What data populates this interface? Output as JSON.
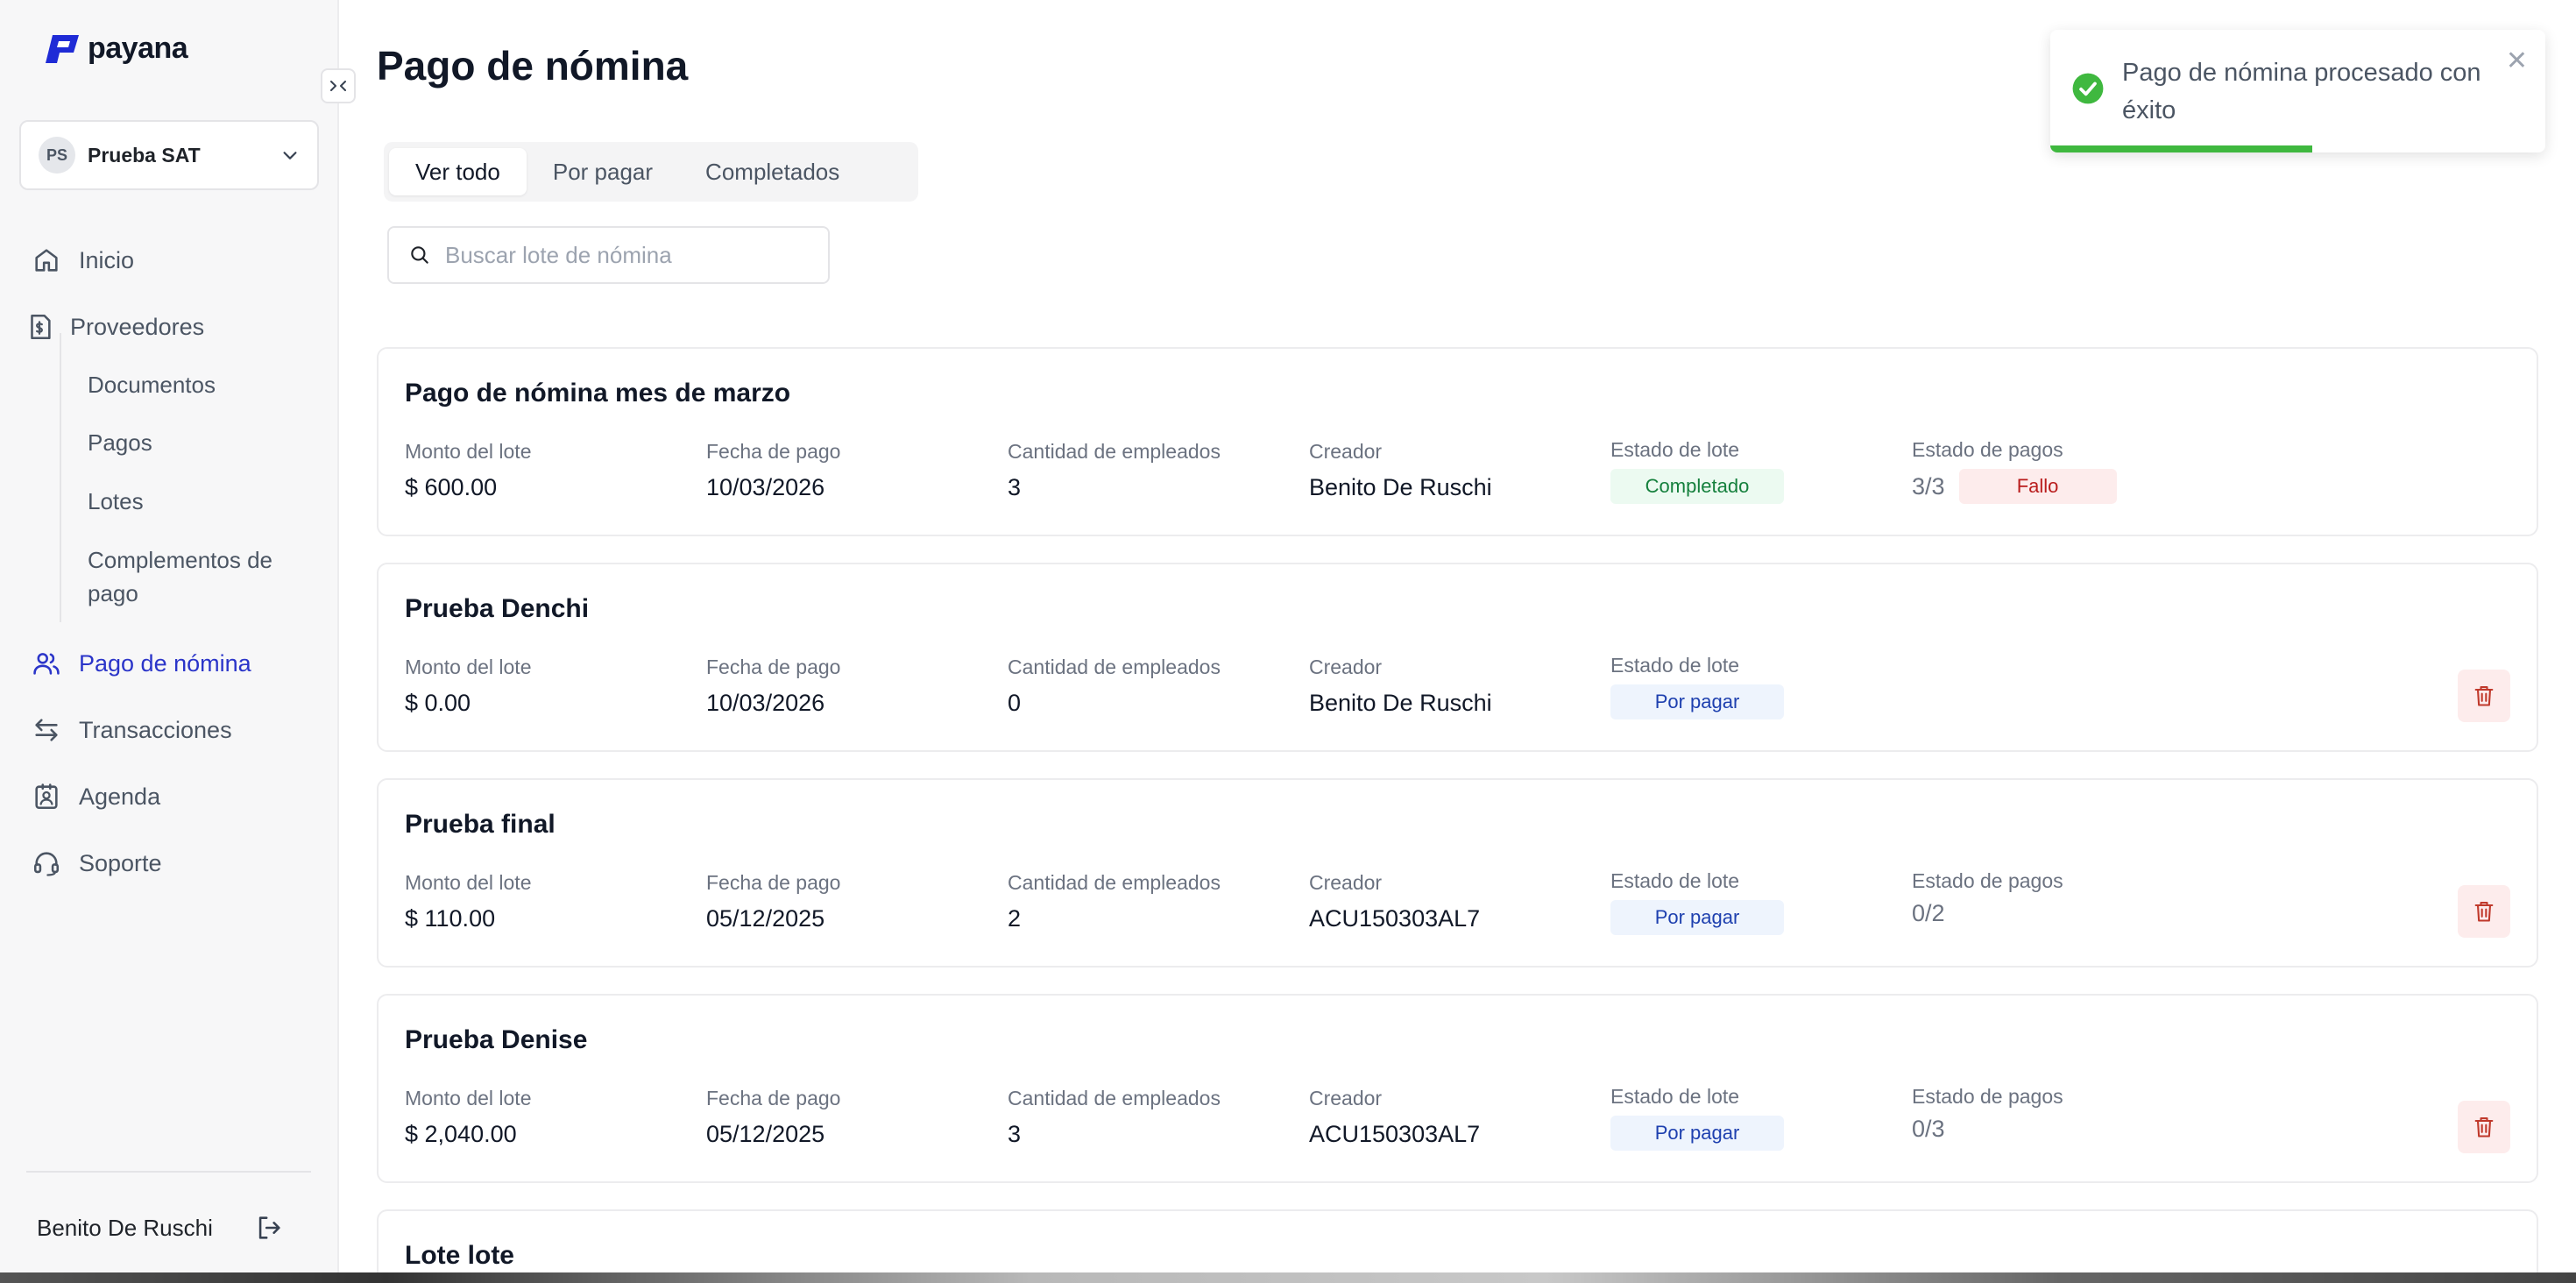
{
  "app": {
    "brand": "payana",
    "accent": "#2b35c9"
  },
  "company": {
    "initials": "PS",
    "name": "Prueba SAT"
  },
  "nav": {
    "inicio": "Inicio",
    "proveedores": "Proveedores",
    "sub": [
      "Documentos",
      "Pagos",
      "Lotes",
      "Complementos de pago"
    ],
    "pago_nomina": "Pago de nómina",
    "transacciones": "Transacciones",
    "agenda": "Agenda",
    "soporte": "Soporte"
  },
  "user": {
    "name": "Benito De Ruschi"
  },
  "page": {
    "title": "Pago de nómina"
  },
  "tabs": [
    "Ver todo",
    "Por pagar",
    "Completados"
  ],
  "search": {
    "placeholder": "Buscar lote de nómina"
  },
  "labels": {
    "monto": "Monto del lote",
    "fecha": "Fecha de pago",
    "cantidad": "Cantidad de empleados",
    "creador": "Creador",
    "estado_lote": "Estado de lote",
    "estado_pagos": "Estado de pagos"
  },
  "batches": [
    {
      "title": "Pago de nómina mes de marzo",
      "monto": "$ 600.00",
      "fecha": "10/03/2026",
      "cantidad": "3",
      "creador": "Benito De Ruschi",
      "estado_lote": "Completado",
      "pagos_count": "3/3",
      "pagos_badge": "Fallo"
    },
    {
      "title": "Prueba Denchi",
      "monto": "$ 0.00",
      "fecha": "10/03/2026",
      "cantidad": "0",
      "creador": "Benito De Ruschi",
      "estado_lote": "Por pagar"
    },
    {
      "title": "Prueba final",
      "monto": "$ 110.00",
      "fecha": "05/12/2025",
      "cantidad": "2",
      "creador": "ACU150303AL7",
      "estado_lote": "Por pagar",
      "pagos_count": "0/2"
    },
    {
      "title": "Prueba Denise",
      "monto": "$ 2,040.00",
      "fecha": "05/12/2025",
      "cantidad": "3",
      "creador": "ACU150303AL7",
      "estado_lote": "Por pagar",
      "pagos_count": "0/3"
    },
    {
      "title": "Lote lote"
    }
  ],
  "toast": {
    "message": "Pago de nómina procesado con éxito",
    "progress": 0.53
  }
}
